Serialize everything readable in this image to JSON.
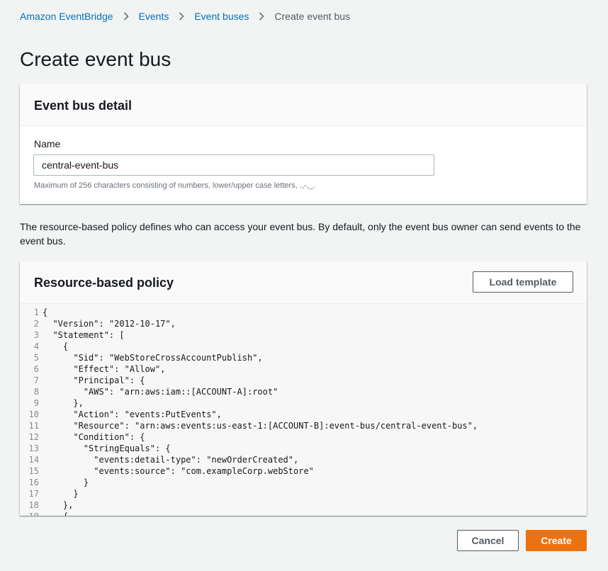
{
  "breadcrumb": {
    "items": [
      "Amazon EventBridge",
      "Events",
      "Event buses"
    ],
    "current": "Create event bus"
  },
  "page_title": "Create event bus",
  "detail_panel": {
    "title": "Event bus detail",
    "name_label": "Name",
    "name_value": "central-event-bus",
    "name_constraint": "Maximum of 256 characters consisting of numbers, lower/upper case letters, .,-,_."
  },
  "description": "The resource-based policy defines who can access your event bus. By default, only the event bus owner can send events to the event bus.",
  "policy_panel": {
    "title": "Resource-based policy",
    "load_template_label": "Load template",
    "code_lines": [
      "{",
      "  \"Version\": \"2012-10-17\",",
      "  \"Statement\": [",
      "    {",
      "      \"Sid\": \"WebStoreCrossAccountPublish\",",
      "      \"Effect\": \"Allow\",",
      "      \"Principal\": {",
      "        \"AWS\": \"arn:aws:iam::[ACCOUNT-A]:root\"",
      "      },",
      "      \"Action\": \"events:PutEvents\",",
      "      \"Resource\": \"arn:aws:events:us-east-1:[ACCOUNT-B]:event-bus/central-event-bus\",",
      "      \"Condition\": {",
      "        \"StringEquals\": {",
      "          \"events:detail-type\": \"newOrderCreated\",",
      "          \"events:source\": \"com.exampleCorp.webStore\"",
      "        }",
      "      }",
      "    },",
      "    {"
    ]
  },
  "footer": {
    "cancel_label": "Cancel",
    "create_label": "Create"
  },
  "colors": {
    "link": "#0073bb",
    "primary": "#ec7211",
    "background": "#f2f3f3"
  }
}
